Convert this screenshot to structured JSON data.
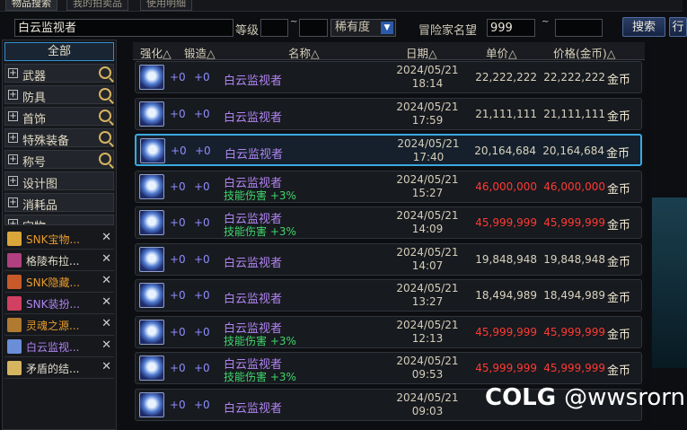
{
  "tabs": [
    "物品搜索",
    "我的拍卖品",
    "使用明细"
  ],
  "filter": {
    "search_value": "白云监视者",
    "level_label": "等级",
    "level_min": "",
    "tilde": "~",
    "level_max": "",
    "rarity_value": "稀有度",
    "adventurer_label": "冒险家名望",
    "fame_min": "999",
    "fame_max": "",
    "search_button": "搜索",
    "row_button": "行"
  },
  "categories": [
    {
      "label": "全部"
    },
    {
      "label": "武器"
    },
    {
      "label": "防具"
    },
    {
      "label": "首饰"
    },
    {
      "label": "特殊装备"
    },
    {
      "label": "称号"
    },
    {
      "label": "设计图"
    },
    {
      "label": "消耗品"
    },
    {
      "label": "宝物"
    }
  ],
  "recent": [
    {
      "label": "SNK宝物...",
      "color": "#e89a2a",
      "icon_color": "#d9a63a"
    },
    {
      "label": "格陵布拉...",
      "color": "#e0dccb",
      "icon_color": "#b04080"
    },
    {
      "label": "SNK隐藏...",
      "color": "#e89a2a",
      "icon_color": "#c85a2a"
    },
    {
      "label": "SNK装扮...",
      "color": "#b084f0",
      "icon_color": "#d04060"
    },
    {
      "label": "灵魂之源...",
      "color": "#e89a2a",
      "icon_color": "#b07a30"
    },
    {
      "label": "白云监视...",
      "color": "#b084f0",
      "icon_color": "#6a8ed8"
    },
    {
      "label": "矛盾的结...",
      "color": "#e0dccb",
      "icon_color": "#d6b460"
    }
  ],
  "headers": {
    "enhance": "强化△",
    "forge": "锻造△",
    "name": "名称△",
    "date": "日期△",
    "unit": "单价△",
    "total": "价格(金币)△"
  },
  "listings": [
    {
      "enh": "+0",
      "forge": "+0",
      "name": "白云监视者",
      "bonus": "",
      "date": "2024/05/21",
      "time": "18:14",
      "unit": "22,222,222",
      "total": "22,222,222",
      "cur": "金币",
      "red": false,
      "sel": false
    },
    {
      "enh": "+0",
      "forge": "+0",
      "name": "白云监视者",
      "bonus": "",
      "date": "2024/05/21",
      "time": "17:59",
      "unit": "21,111,111",
      "total": "21,111,111",
      "cur": "金币",
      "red": false,
      "sel": false
    },
    {
      "enh": "+0",
      "forge": "+0",
      "name": "白云监视者",
      "bonus": "",
      "date": "2024/05/21",
      "time": "17:40",
      "unit": "20,164,684",
      "total": "20,164,684",
      "cur": "金币",
      "red": false,
      "sel": true
    },
    {
      "enh": "+0",
      "forge": "+0",
      "name": "白云监视者",
      "bonus": "技能伤害 +3%",
      "date": "2024/05/21",
      "time": "15:27",
      "unit": "46,000,000",
      "total": "46,000,000",
      "cur": "金币",
      "red": true,
      "sel": false
    },
    {
      "enh": "+0",
      "forge": "+0",
      "name": "白云监视者",
      "bonus": "技能伤害 +3%",
      "date": "2024/05/21",
      "time": "14:09",
      "unit": "45,999,999",
      "total": "45,999,999",
      "cur": "金币",
      "red": true,
      "sel": false
    },
    {
      "enh": "+0",
      "forge": "+0",
      "name": "白云监视者",
      "bonus": "",
      "date": "2024/05/21",
      "time": "14:07",
      "unit": "19,848,948",
      "total": "19,848,948",
      "cur": "金币",
      "red": false,
      "sel": false
    },
    {
      "enh": "+0",
      "forge": "+0",
      "name": "白云监视者",
      "bonus": "",
      "date": "2024/05/21",
      "time": "13:27",
      "unit": "18,494,989",
      "total": "18,494,989",
      "cur": "金币",
      "red": false,
      "sel": false
    },
    {
      "enh": "+0",
      "forge": "+0",
      "name": "白云监视者",
      "bonus": "技能伤害 +3%",
      "date": "2024/05/21",
      "time": "12:13",
      "unit": "45,999,999",
      "total": "45,999,999",
      "cur": "金币",
      "red": true,
      "sel": false
    },
    {
      "enh": "+0",
      "forge": "+0",
      "name": "白云监视者",
      "bonus": "技能伤害 +3%",
      "date": "2024/05/21",
      "time": "09:53",
      "unit": "45,999,999",
      "total": "45,999,999",
      "cur": "金币",
      "red": true,
      "sel": false
    },
    {
      "enh": "+0",
      "forge": "+0",
      "name": "白云监视者",
      "bonus": "",
      "date": "2024/05/21",
      "time": "09:03",
      "unit": "",
      "total": "",
      "cur": "",
      "red": false,
      "sel": false
    }
  ],
  "watermark": {
    "logo": "COLG",
    "handle": "@wwsrorn"
  }
}
